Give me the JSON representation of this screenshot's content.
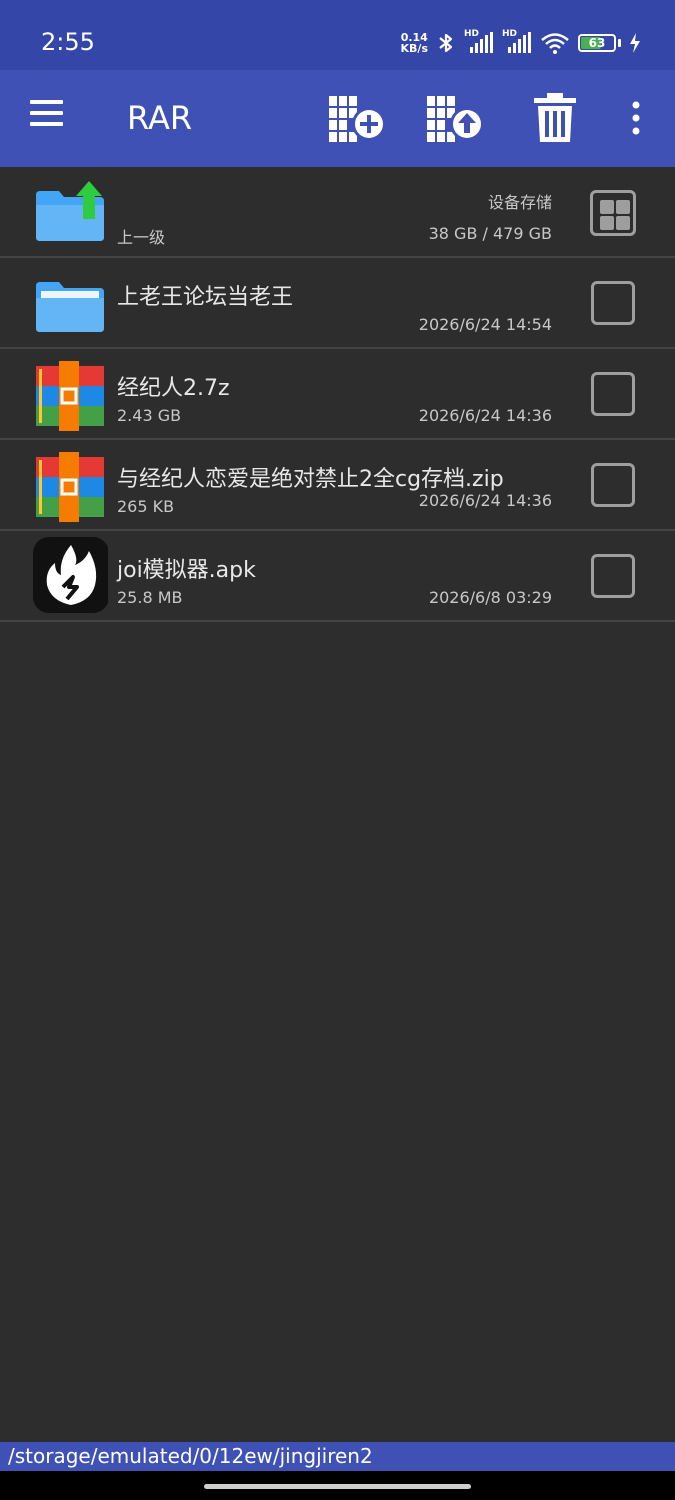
{
  "status_bar": {
    "time": "2:55",
    "net_speed_value": "0.14",
    "net_speed_unit": "KB/s",
    "signal_label_1": "HD",
    "signal_label_2": "HD",
    "battery_level": "63",
    "battery_fraction": 0.63,
    "icons": [
      "bluetooth-icon",
      "signal-icon",
      "signal-icon",
      "wifi-icon",
      "battery-icon",
      "charging-icon"
    ]
  },
  "toolbar": {
    "title": "RAR",
    "icons": [
      "menu-icon",
      "add-to-archive-icon",
      "extract-icon",
      "delete-icon",
      "more-vert-icon"
    ]
  },
  "list": {
    "parent": {
      "label": "上一级",
      "storage_label": "设备存储",
      "storage_usage": "38 GB / 479 GB"
    },
    "items": [
      {
        "name": "上老王论坛当老王",
        "size": "",
        "date": "2026/6/24 14:54",
        "icon": "folder-icon"
      },
      {
        "name": "经纪人2.7z",
        "size": "2.43 GB",
        "date": "2026/6/24 14:36",
        "icon": "rar-archive-icon"
      },
      {
        "name": "与经纪人恋爱是绝对禁止2全cg存档.zip",
        "size": "265 KB",
        "date": "2026/6/24 14:36",
        "icon": "rar-archive-icon"
      },
      {
        "name": "joi模拟器.apk",
        "size": "25.8 MB",
        "date": "2026/6/8 03:29",
        "icon": "flame-app-icon"
      }
    ]
  },
  "path_bar": {
    "path": "/storage/emulated/0/12ew/jingjiren2"
  },
  "colors": {
    "status_bar": "#3446a8",
    "toolbar": "#3f51b5",
    "background": "#2d2d2d",
    "folder": "#64b5f6",
    "up_arrow": "#2ecc40"
  }
}
